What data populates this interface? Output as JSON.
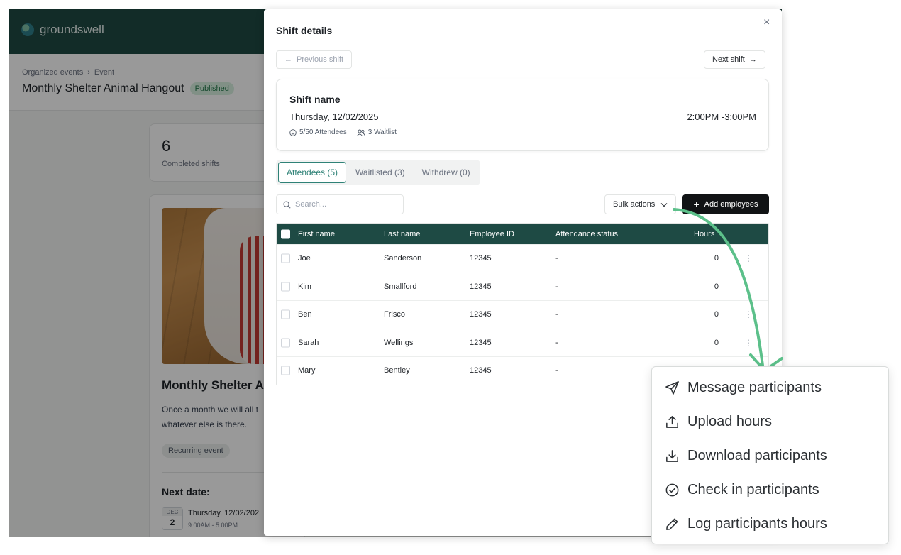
{
  "app": {
    "brand": "groundswell",
    "breadcrumb": [
      "Organized events",
      "Event"
    ],
    "event_title": "Monthly Shelter Animal Hangout",
    "status_badge": "Published",
    "stat": {
      "value": "6",
      "label": "Completed shifts"
    },
    "event_card": {
      "name": "Monthly Shelter A",
      "description": "Once a month we will all t whatever else is there.",
      "tag": "Recurring event",
      "next_date_label": "Next date:",
      "cal_month": "DEC",
      "cal_day": "2",
      "date": "Thursday, 12/02/202",
      "time": "9:00AM - 5:00PM"
    }
  },
  "modal": {
    "title": "Shift details",
    "close": "×",
    "prev_label": "Previous shift",
    "next_label": "Next shift",
    "shift": {
      "name": "Shift name",
      "date": "Thursday, 12/02/2025",
      "time": "2:00PM -3:00PM",
      "attendees": "5/50 Attendees",
      "waitlist": "3 Waitlist"
    },
    "tabs": [
      {
        "label": "Attendees (5)",
        "active": true
      },
      {
        "label": "Waitlisted (3)",
        "active": false
      },
      {
        "label": "Withdrew (0)",
        "active": false
      }
    ],
    "search_placeholder": "Search...",
    "bulk_actions": "Bulk actions",
    "add_employees": "Add employees",
    "table": {
      "headers": [
        "First name",
        "Last name",
        "Employee ID",
        "Attendance status",
        "Hours"
      ],
      "rows": [
        {
          "first": "Joe",
          "last": "Sanderson",
          "id": "12345",
          "status": "-",
          "hours": "0"
        },
        {
          "first": "Kim",
          "last": "Smallford",
          "id": "12345",
          "status": "-",
          "hours": "0"
        },
        {
          "first": "Ben",
          "last": "Frisco",
          "id": "12345",
          "status": "-",
          "hours": "0"
        },
        {
          "first": "Sarah",
          "last": "Wellings",
          "id": "12345",
          "status": "-",
          "hours": "0"
        },
        {
          "first": "Mary",
          "last": "Bentley",
          "id": "12345",
          "status": "-",
          "hours": ""
        }
      ]
    }
  },
  "menu": {
    "items": [
      {
        "label": "Message participants",
        "icon": "send-icon"
      },
      {
        "label": "Upload hours",
        "icon": "upload-icon"
      },
      {
        "label": "Download participants",
        "icon": "download-icon"
      },
      {
        "label": "Check in participants",
        "icon": "check-circle-icon"
      },
      {
        "label": "Log participants hours",
        "icon": "pencil-icon"
      }
    ]
  },
  "colors": {
    "header_green": "#1e4a44",
    "accent_teal": "#2f8277",
    "arrow_green": "#5cc08a",
    "badge_green": "#d7f0e0"
  }
}
